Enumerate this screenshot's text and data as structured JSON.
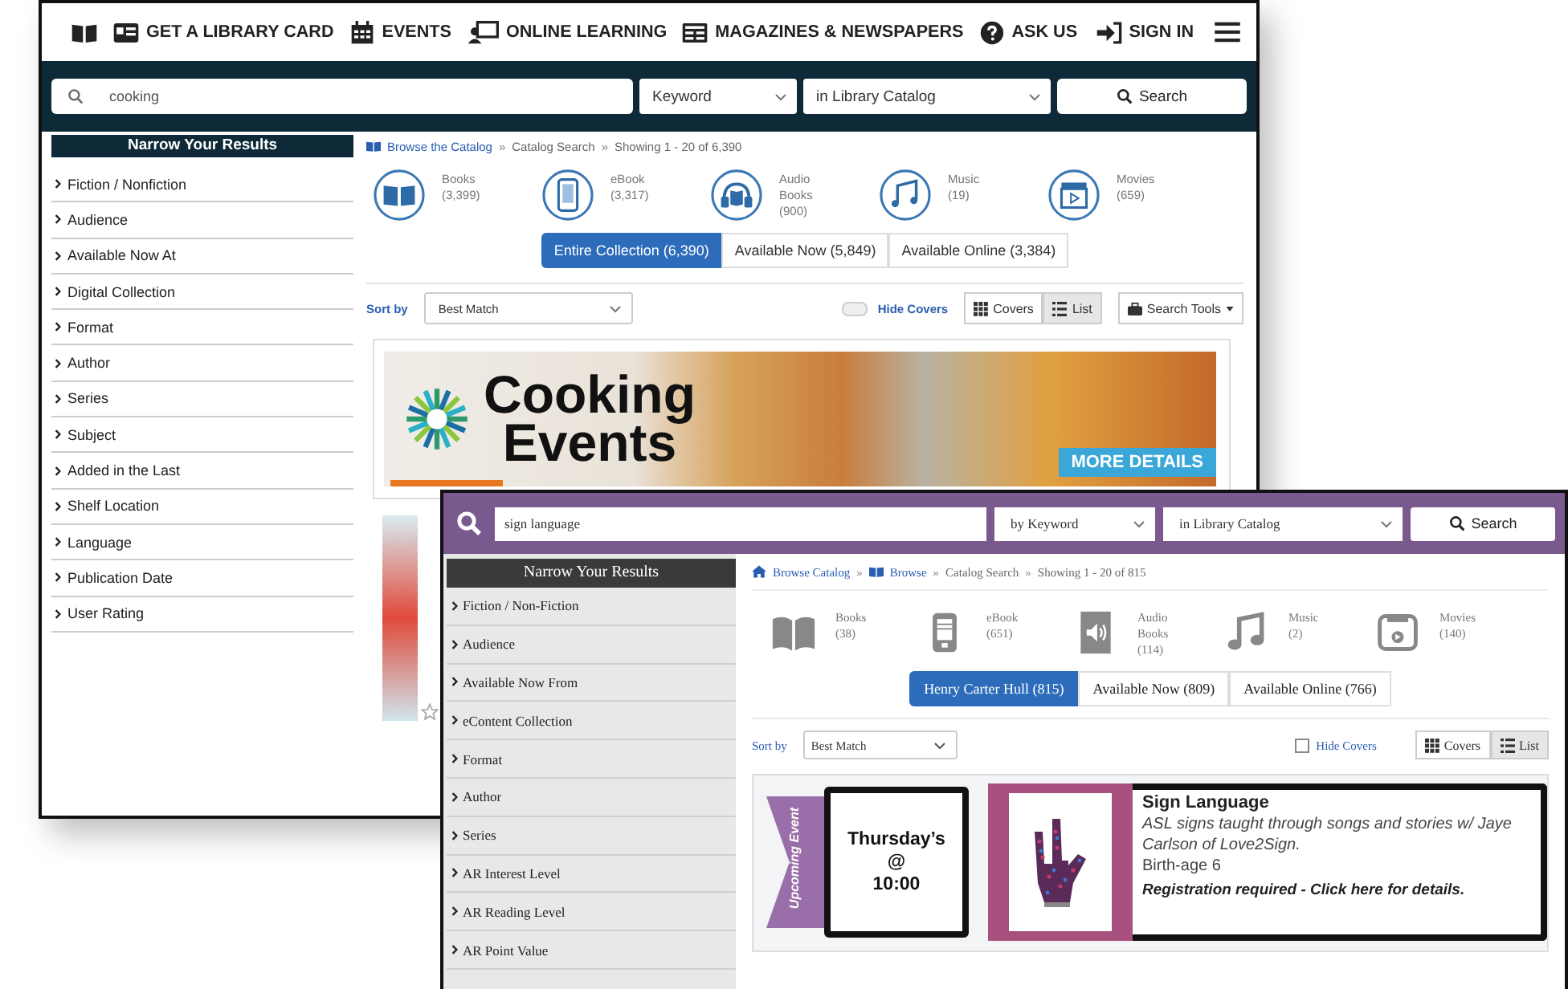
{
  "back_window": {
    "nav": {
      "items": [
        "GET A LIBRARY CARD",
        "EVENTS",
        "ONLINE LEARNING",
        "MAGAZINES & NEWSPAPERS",
        "ASK US"
      ],
      "sign_in": "SIGN IN"
    },
    "search": {
      "value": "cooking",
      "search_by": "Keyword",
      "search_in": "in Library Catalog",
      "button": "Search"
    },
    "sidebar": {
      "title": "Narrow Your Results",
      "items": [
        "Fiction / Nonfiction",
        "Audience",
        "Available Now At",
        "Digital Collection",
        "Format",
        "Author",
        "Series",
        "Subject",
        "Added in the Last",
        "Shelf Location",
        "Language",
        "Publication Date",
        "User Rating"
      ]
    },
    "breadcrumb": [
      {
        "text": "Browse the Catalog",
        "link": true
      },
      {
        "sep": "»",
        "text": "Catalog Search",
        "link": false
      },
      {
        "sep": "»",
        "text": "Showing 1 - 20 of 6,390",
        "link": false
      }
    ],
    "formats": [
      {
        "label": "Books",
        "count": "(3,399)"
      },
      {
        "label": "eBook",
        "count": "(3,317)"
      },
      {
        "label": "Audio Books",
        "count": "(900)"
      },
      {
        "label": "Music",
        "count": "(19)"
      },
      {
        "label": "Movies",
        "count": "(659)"
      }
    ],
    "scopes": [
      {
        "label": "Entire Collection (6,390)",
        "selected": true
      },
      {
        "label": "Available Now (5,849)",
        "selected": false
      },
      {
        "label": "Available Online (3,384)",
        "selected": false
      }
    ],
    "toolbar": {
      "sort_label": "Sort by",
      "sort_value": "Best Match",
      "hide_covers": {
        "label": "Hide Covers",
        "on": false
      },
      "views": [
        {
          "label": "Covers",
          "selected": false
        },
        {
          "label": "List",
          "selected": true
        }
      ],
      "tools": "Search Tools"
    },
    "banner": {
      "title_lines": [
        "Cooking",
        "Events"
      ],
      "button": "MORE DETAILS"
    }
  },
  "front_window": {
    "search": {
      "value": "sign language",
      "search_by": "by Keyword",
      "search_in": "in Library Catalog",
      "button": "Search"
    },
    "sidebar": {
      "title": "Narrow Your Results",
      "items": [
        "Fiction / Non-Fiction",
        "Audience",
        "Available Now From",
        "eContent Collection",
        "Format",
        "Author",
        "Series",
        "AR Interest Level",
        "AR Reading Level",
        "AR Point Value"
      ]
    },
    "breadcrumb": [
      {
        "text": "Browse Catalog",
        "link": true
      },
      {
        "sep": "»",
        "text": "Browse",
        "link": true
      },
      {
        "sep": "»",
        "text": "Catalog Search",
        "link": false
      },
      {
        "sep": "»",
        "text": "Showing 1 - 20 of 815",
        "link": false
      }
    ],
    "formats": [
      {
        "label": "Books",
        "count": "(38)"
      },
      {
        "label": "eBook",
        "count": "(651)"
      },
      {
        "label": "Audio Books",
        "count": "(114)"
      },
      {
        "label": "Music",
        "count": "(2)"
      },
      {
        "label": "Movies",
        "count": "(140)"
      }
    ],
    "scopes": [
      {
        "label": "Henry Carter Hull (815)",
        "selected": true
      },
      {
        "label": "Available Now (809)",
        "selected": false
      },
      {
        "label": "Available Online (766)",
        "selected": false
      }
    ],
    "toolbar": {
      "sort_label": "Sort by",
      "sort_value": "Best Match",
      "hide_covers": {
        "label": "Hide Covers",
        "checked": false
      },
      "views": [
        {
          "label": "Covers",
          "selected": false
        },
        {
          "label": "List",
          "selected": true
        }
      ]
    },
    "event": {
      "ribbon": "Upcoming Event",
      "when_lines": [
        "Thursday’s",
        "@",
        "10:00"
      ],
      "title": "Sign Language",
      "description": "ASL signs taught through songs and stories w/ Jaye Carlson of Love2Sign.",
      "ages": "Birth-age 6",
      "note": "Registration required - Click here for details."
    }
  }
}
